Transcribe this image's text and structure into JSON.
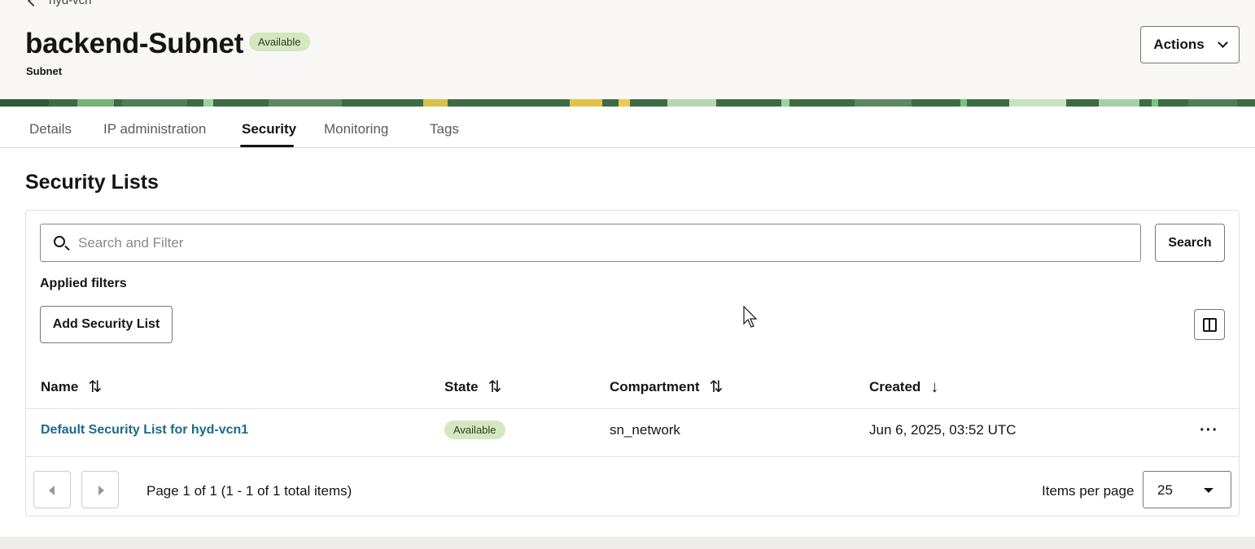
{
  "breadcrumb": {
    "parent": "hyd-vcn"
  },
  "header": {
    "title": "backend-Subnet",
    "status": "Available",
    "subtitle": "Subnet",
    "actions_label": "Actions"
  },
  "tabs": [
    {
      "label": "Details"
    },
    {
      "label": "IP administration"
    },
    {
      "label": "Security",
      "active": true
    },
    {
      "label": "Monitoring"
    },
    {
      "label": "Tags"
    }
  ],
  "section": {
    "title": "Security Lists"
  },
  "search": {
    "placeholder": "Search and Filter",
    "value": "",
    "button_label": "Search"
  },
  "filters": {
    "label": "Applied filters"
  },
  "toolbar": {
    "add_label": "Add Security List"
  },
  "table": {
    "columns": [
      {
        "label": "Name",
        "sort": "both"
      },
      {
        "label": "State",
        "sort": "both"
      },
      {
        "label": "Compartment",
        "sort": "both"
      },
      {
        "label": "Created",
        "sort": "desc"
      }
    ],
    "rows": [
      {
        "name": "Default Security List for hyd-vcn1",
        "state": "Available",
        "compartment": "sn_network",
        "created": "Jun 6, 2025, 03:52 UTC"
      }
    ]
  },
  "pagination": {
    "info": "Page 1 of 1 (1 - 1 of 1 total items)",
    "items_per_page_label": "Items per page",
    "items_per_page": "25"
  },
  "icons": {
    "back": "chevron-left-icon",
    "actions": "chevron-down-icon",
    "search": "search-icon",
    "columns": "columns-icon",
    "sort_both": "sort-icon",
    "sort_desc": "arrow-down-icon",
    "row_menu": "more-icon",
    "prev": "caret-left-icon",
    "next": "caret-right-icon",
    "select": "caret-down-icon"
  },
  "colors": {
    "badge_bg": "#d4e7c0",
    "link": "#1c6a86",
    "banner": "#3e6b45"
  }
}
